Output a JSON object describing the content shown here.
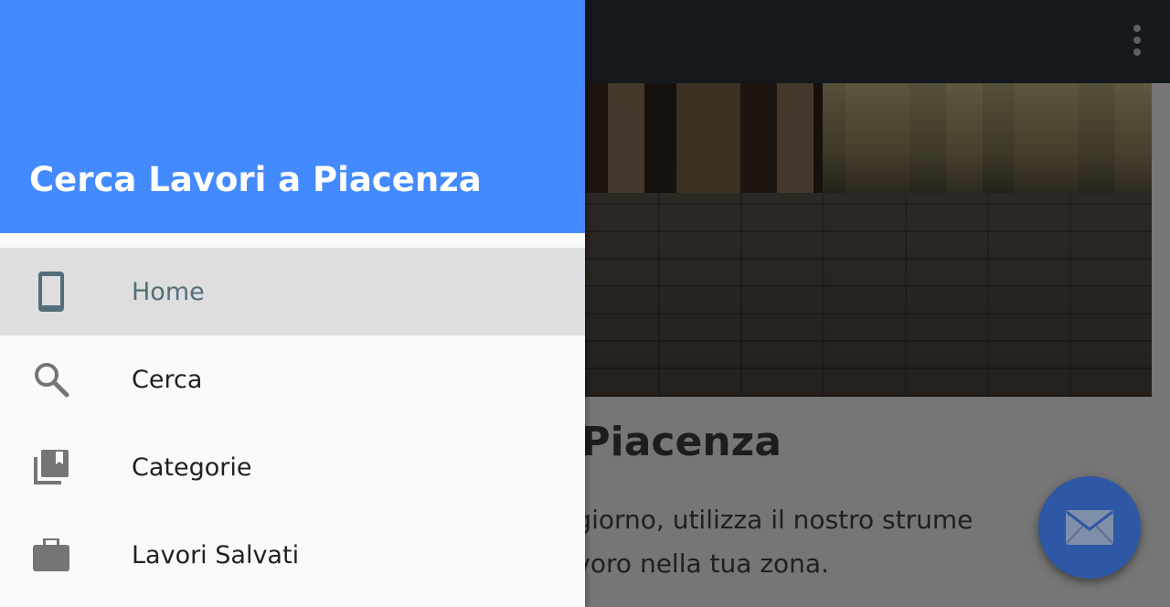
{
  "colors": {
    "toolbar": "#263238",
    "drawer_header": "#448aff",
    "fab": "#2e57a6",
    "active_item_bg": "#dedede",
    "active_label": "#546e7a"
  },
  "drawer": {
    "title": "Cerca Lavori a Piacenza",
    "items": [
      {
        "label": "Home",
        "icon": "phone-icon",
        "active": true
      },
      {
        "label": "Cerca",
        "icon": "search-icon",
        "active": false
      },
      {
        "label": "Categorie",
        "icon": "library-books-icon",
        "active": false
      },
      {
        "label": "Lavori Salvati",
        "icon": "briefcase-icon",
        "active": false
      }
    ]
  },
  "main": {
    "title_visible": "i a Piacenza",
    "body_line1": "ogni giorno, utilizza il nostro strume",
    "body_line2": " un lavoro nella tua zona."
  },
  "toolbar": {
    "overflow_icon": "more-vert-icon"
  },
  "fab": {
    "icon": "email-icon"
  }
}
